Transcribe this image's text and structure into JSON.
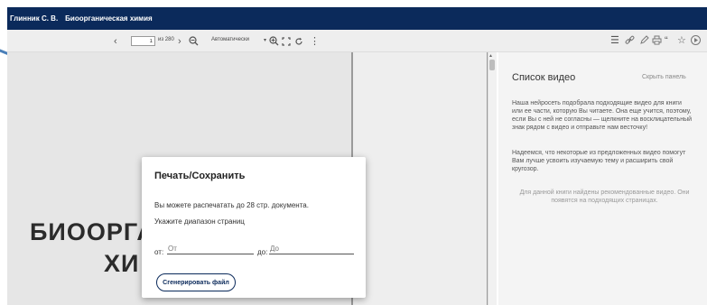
{
  "window": {
    "author": "Глинник С. В.",
    "book": "Биоорганическая химия"
  },
  "toolbar": {
    "current_page": "1",
    "total_pages": "из 280",
    "zoom": "Автоматически",
    "icons": [
      "chevron-left-icon",
      "chevron-right-icon",
      "zoom-out-icon",
      "zoom-in-icon",
      "fullscreen-icon",
      "rotate-icon",
      "more-icon",
      "list-icon",
      "link-icon",
      "pen-icon",
      "print-icon",
      "quote-icon",
      "star-icon",
      "play-icon"
    ]
  },
  "document": {
    "title_line1": "БИООРГА",
    "title_line2": "ХИ"
  },
  "video_panel": {
    "title": "Список видео",
    "hide_label": "Скрыть панель",
    "para1": "Наша нейросеть подобрала подходящие видео для книги или ее части, которую Вы читаете. Она еще учится, поэтому, если Вы с ней не согласны — щелкните на восклицательный знак рядом с видео и отправьте нам весточку!",
    "para2": "Надеемся, что некоторые из предложенных видео помогут Вам лучше усвоить изучаемую тему и расширить свой кругозор.",
    "note": "Для данной книги найдены рекомендованные видео. Они появятся на подходящих страницах."
  },
  "dialog": {
    "title": "Печать/Сохранить",
    "info": "Вы можете распечатать до 28 стр. документа.",
    "range_label": "Укажите диапазон страниц",
    "from_label": "от:",
    "from_placeholder": "От",
    "to_label": "до:",
    "to_placeholder": "До",
    "generate_label": "Сгенерировать файл"
  },
  "colors": {
    "header": "#0b2a5b",
    "accent": "#0b2a5b"
  }
}
